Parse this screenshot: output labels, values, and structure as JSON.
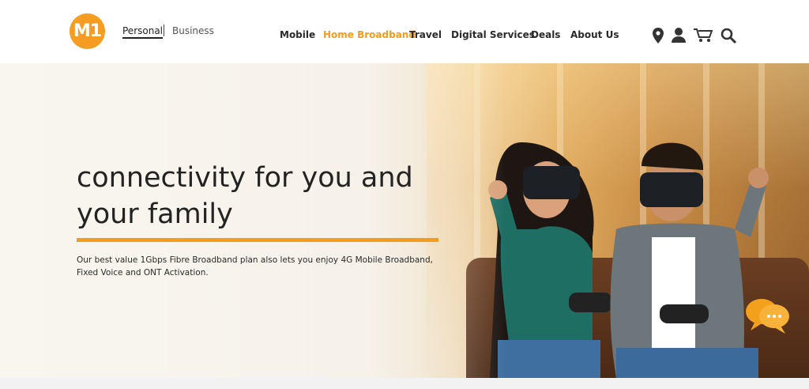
{
  "brand": {
    "logo_text": "M1",
    "accent": "#f39c1f"
  },
  "segments": {
    "personal": "Personal",
    "business": "Business",
    "active": "Personal"
  },
  "nav": {
    "items": [
      {
        "label": "Mobile"
      },
      {
        "label": "Home Broadband",
        "active": true
      },
      {
        "label": "Travel"
      },
      {
        "label": "Digital Services"
      },
      {
        "label": "Deals"
      },
      {
        "label": "About Us"
      }
    ]
  },
  "header_icons": [
    "location-pin-icon",
    "user-icon",
    "cart-icon",
    "search-icon"
  ],
  "hero": {
    "title": "connectivity for you and your family",
    "description": "Our best value 1Gbps Fibre Broadband plan also lets you enjoy 4G Mobile Broadband, Fixed Voice and ONT Activation."
  },
  "chat": {
    "icon": "chat-bubbles-icon",
    "color": "#f5a623"
  }
}
